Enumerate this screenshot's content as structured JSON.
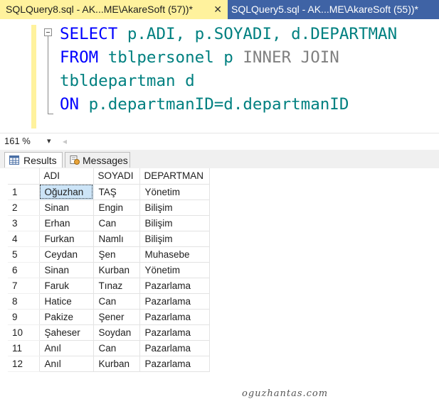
{
  "tabs": [
    {
      "label": "SQLQuery8.sql - AK...ME\\AkareSoft (57))*",
      "active": true,
      "close": "✕"
    },
    {
      "label": "SQLQuery5.sql - AK...ME\\AkareSoft (55))*",
      "active": false
    }
  ],
  "editor": {
    "lines": [
      [
        {
          "t": "SELECT",
          "c": "kw"
        },
        {
          "t": " p.ADI, p.SOYADI, d.DEPARTMAN",
          "c": "id"
        }
      ],
      [
        {
          "t": "FROM",
          "c": "kw"
        },
        {
          "t": " tblpersonel p ",
          "c": "id"
        },
        {
          "t": "INNER JOIN",
          "c": "gray"
        }
      ],
      [
        {
          "t": "tbldepartman d",
          "c": "id"
        }
      ],
      [
        {
          "t": "ON",
          "c": "kw"
        },
        {
          "t": " p.departmanID=d.departmanID",
          "c": "id"
        }
      ]
    ]
  },
  "zoom": {
    "value": "161 %",
    "arrow": "▾",
    "scroll_left": "◂"
  },
  "result_tabs": {
    "results": "Results",
    "messages": "Messages"
  },
  "grid": {
    "columns": [
      "ADI",
      "SOYADI",
      "DEPARTMAN"
    ],
    "rows": [
      [
        "1",
        "Oğuzhan",
        "TAŞ",
        "Yönetim"
      ],
      [
        "2",
        "Sinan",
        "Engin",
        "Bilişim"
      ],
      [
        "3",
        "Erhan",
        "Can",
        "Bilişim"
      ],
      [
        "4",
        "Furkan",
        "Namlı",
        "Bilişim"
      ],
      [
        "5",
        "Ceydan",
        "Şen",
        "Muhasebe"
      ],
      [
        "6",
        "Sinan",
        "Kurban",
        "Yönetim"
      ],
      [
        "7",
        "Faruk",
        "Tınaz",
        "Pazarlama"
      ],
      [
        "8",
        "Hatice",
        "Can",
        "Pazarlama"
      ],
      [
        "9",
        "Pakize",
        "Şener",
        "Pazarlama"
      ],
      [
        "10",
        "Şaheser",
        "Soydan",
        "Pazarlama"
      ],
      [
        "11",
        "Anıl",
        "Can",
        "Pazarlama"
      ],
      [
        "12",
        "Anıl",
        "Kurban",
        "Pazarlama"
      ]
    ]
  },
  "watermark": "oguzhantas.com",
  "colors": {
    "tab_active": "#fff29d",
    "tab_bar": "#3f63a5",
    "keyword": "#0000ff",
    "identifier": "#008080",
    "join": "#808080",
    "selection": "#cce4f7"
  }
}
